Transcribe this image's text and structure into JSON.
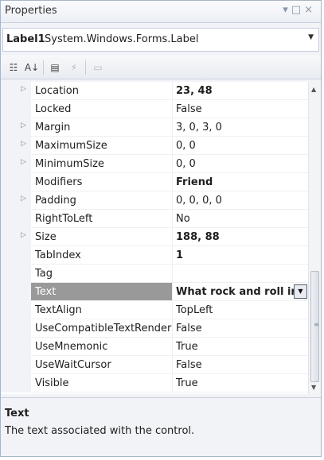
{
  "window": {
    "title": "Properties",
    "controls": [
      "▾",
      "□",
      "×"
    ]
  },
  "object_selector": {
    "name": "Label1",
    "type": "System.Windows.Forms.Label"
  },
  "toolbar": {
    "buttons": [
      "categorized-icon",
      "alphabetical-icon",
      "properties-icon",
      "events-icon",
      "property-pages-icon"
    ]
  },
  "properties": [
    {
      "name": "Location",
      "value": "23, 48",
      "bold": true,
      "expandable": true
    },
    {
      "name": "Locked",
      "value": "False",
      "bold": false,
      "expandable": false
    },
    {
      "name": "Margin",
      "value": "3, 0, 3, 0",
      "bold": false,
      "expandable": true
    },
    {
      "name": "MaximumSize",
      "value": "0, 0",
      "bold": false,
      "expandable": true
    },
    {
      "name": "MinimumSize",
      "value": "0, 0",
      "bold": false,
      "expandable": true
    },
    {
      "name": "Modifiers",
      "value": "Friend",
      "bold": true,
      "expandable": false
    },
    {
      "name": "Padding",
      "value": "0, 0, 0, 0",
      "bold": false,
      "expandable": true
    },
    {
      "name": "RightToLeft",
      "value": "No",
      "bold": false,
      "expandable": false
    },
    {
      "name": "Size",
      "value": "188, 88",
      "bold": true,
      "expandable": true
    },
    {
      "name": "TabIndex",
      "value": "1",
      "bold": true,
      "expandable": false
    },
    {
      "name": "Tag",
      "value": "",
      "bold": false,
      "expandable": false
    },
    {
      "name": "Text",
      "value": "What rock and roll ins",
      "bold": true,
      "expandable": false,
      "selected": true
    },
    {
      "name": "TextAlign",
      "value": "TopLeft",
      "bold": false,
      "expandable": false
    },
    {
      "name": "UseCompatibleTextRender",
      "value": "False",
      "bold": false,
      "expandable": false
    },
    {
      "name": "UseMnemonic",
      "value": "True",
      "bold": false,
      "expandable": false
    },
    {
      "name": "UseWaitCursor",
      "value": "False",
      "bold": false,
      "expandable": false
    },
    {
      "name": "Visible",
      "value": "True",
      "bold": false,
      "expandable": false
    }
  ],
  "description": {
    "title": "Text",
    "text": "The text associated with the control."
  }
}
